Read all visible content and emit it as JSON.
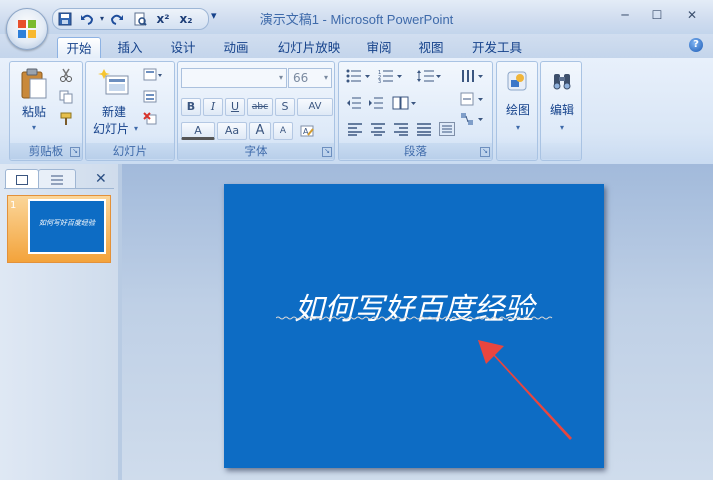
{
  "window": {
    "title": "演示文稿1 - Microsoft PowerPoint",
    "minimize": "─",
    "maximize": "☐",
    "close": "✕"
  },
  "quick_access": {
    "icons": [
      "save-icon",
      "undo-icon",
      "redo-icon",
      "print-preview-icon",
      "superscript-icon",
      "subscript-icon"
    ],
    "superscript": "x²",
    "subscript": "x₂",
    "more": "▾"
  },
  "tabs": [
    {
      "label": "开始",
      "active": true
    },
    {
      "label": "插入"
    },
    {
      "label": "设计"
    },
    {
      "label": "动画"
    },
    {
      "label": "幻灯片放映"
    },
    {
      "label": "审阅"
    },
    {
      "label": "视图"
    },
    {
      "label": "开发工具"
    }
  ],
  "help": "?",
  "ribbon": {
    "clipboard": {
      "paste_label": "粘贴",
      "group_label": "剪贴板"
    },
    "slides": {
      "new_slide_line1": "新建",
      "new_slide_line2": "幻灯片",
      "group_label": "幻灯片"
    },
    "font": {
      "font_name": "",
      "font_size": "66",
      "bold": "B",
      "italic": "I",
      "underline": "U",
      "strike": "abc",
      "shadow": "S",
      "spacing": "AV",
      "color": "A",
      "case": "Aa",
      "grow": "A",
      "shrink": "A",
      "group_label": "字体"
    },
    "paragraph": {
      "group_label": "段落"
    },
    "drawing": {
      "label": "绘图"
    },
    "editing": {
      "label": "编辑"
    }
  },
  "slides_pane": {
    "close": "✕",
    "thumbnails": [
      {
        "number": "1",
        "text": "如何写好百度经验"
      }
    ]
  },
  "slide": {
    "title": "如何写好百度经验",
    "background": "#0d6cc4",
    "annotation": "red-arrow-pointing-to-squiggly-underline"
  },
  "colors": {
    "accent_orange": "#f3a33b",
    "arrow_red": "#e8463f",
    "ribbon_blue": "#15428b"
  }
}
